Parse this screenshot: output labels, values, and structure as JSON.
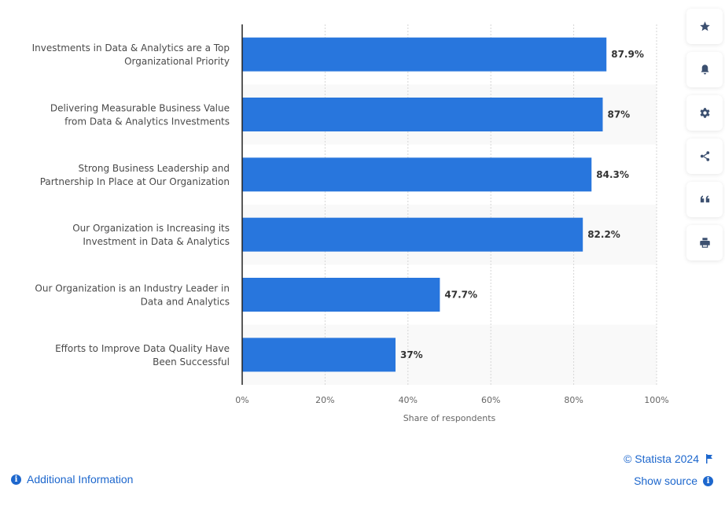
{
  "chart_data": {
    "type": "bar",
    "orientation": "horizontal",
    "categories": [
      [
        "Investments in Data & Analytics are a Top",
        "Organizational Priority"
      ],
      [
        "Delivering Measurable Business Value",
        "from Data & Analytics Investments"
      ],
      [
        "Strong Business Leadership and",
        "Partnership In Place at Our Organization"
      ],
      [
        "Our Organization is Increasing its",
        "Investment in Data & Analytics"
      ],
      [
        "Our Organization is an Industry Leader in",
        "Data and Analytics"
      ],
      [
        "Efforts to Improve Data Quality Have",
        "Been Successful"
      ]
    ],
    "values": [
      87.9,
      87,
      84.3,
      82.2,
      47.7,
      37
    ],
    "value_labels": [
      "87.9%",
      "87%",
      "84.3%",
      "82.2%",
      "47.7%",
      "37%"
    ],
    "xlabel": "Share of respondents",
    "ylabel": "",
    "xlim": [
      0,
      100
    ],
    "ticks": [
      0,
      20,
      40,
      60,
      80,
      100
    ],
    "tick_labels": [
      "0%",
      "20%",
      "40%",
      "60%",
      "80%",
      "100%"
    ],
    "grid": true,
    "legend": "none",
    "bar_color": "#2876dd"
  },
  "toolbar": {
    "buttons": [
      {
        "name": "favorite",
        "icon": "star-icon"
      },
      {
        "name": "notifications",
        "icon": "bell-icon"
      },
      {
        "name": "settings",
        "icon": "gear-icon"
      },
      {
        "name": "share",
        "icon": "share-icon"
      },
      {
        "name": "cite",
        "icon": "quote-icon"
      },
      {
        "name": "print",
        "icon": "print-icon"
      }
    ]
  },
  "footer": {
    "copyright": "© Statista 2024",
    "additional_info": "Additional Information",
    "show_source": "Show source"
  },
  "colors": {
    "accent": "#1d67cd",
    "bar": "#2876dd"
  }
}
